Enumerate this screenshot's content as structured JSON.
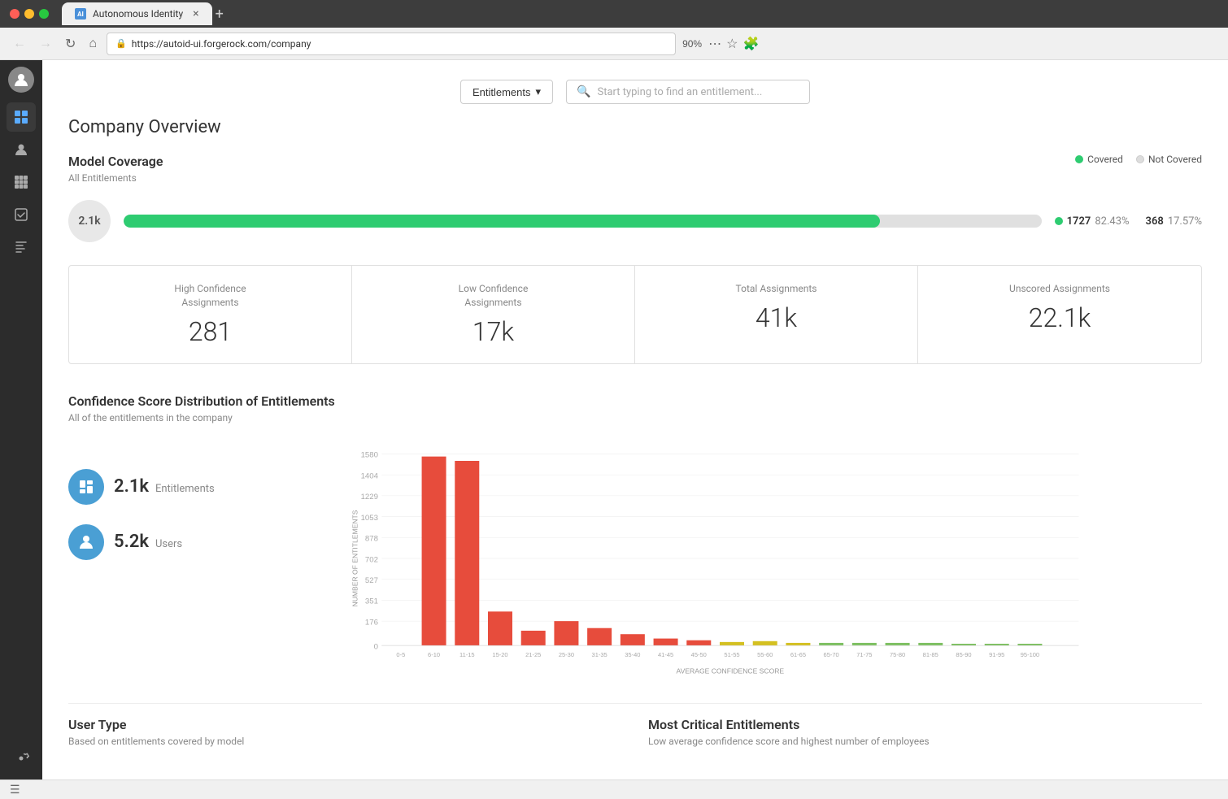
{
  "browser": {
    "traffic_lights": [
      "red",
      "yellow",
      "green"
    ],
    "tab_label": "Autonomous Identity",
    "tab_favicon_text": "AI",
    "address": "https://autoid-ui.forgerock.com/company",
    "zoom": "90%",
    "new_tab_label": "+"
  },
  "header": {
    "entitlements_btn": "Entitlements",
    "search_placeholder": "Start typing to find an entitlement..."
  },
  "page": {
    "title": "Company Overview"
  },
  "model_coverage": {
    "section_title": "Model Coverage",
    "section_subtitle": "All Entitlements",
    "legend": {
      "covered_label": "Covered",
      "not_covered_label": "Not Covered"
    },
    "total": "2.1k",
    "bar_fill_pct": 82.43,
    "covered_count": "1727",
    "covered_pct": "82.43%",
    "not_covered_count": "368",
    "not_covered_pct": "17.57%"
  },
  "stats": [
    {
      "label": "High Confidence\nAssignments",
      "value": "281"
    },
    {
      "label": "Low Confidence\nAssignments",
      "value": "17k"
    },
    {
      "label": "Total Assignments",
      "value": "41k"
    },
    {
      "label": "Unscored Assignments",
      "value": "22.1k"
    }
  ],
  "chart": {
    "title": "Confidence Score Distribution of Entitlements",
    "subtitle": "All of the entitlements in the company",
    "y_axis_label": "NUMBER OF ENTITLEMENTS",
    "x_axis_label": "AVERAGE CONFIDENCE SCORE",
    "y_ticks": [
      "0",
      "176",
      "351",
      "527",
      "702",
      "878",
      "1053",
      "1229",
      "1404",
      "1580"
    ],
    "x_labels": [
      "0-5",
      "6-10",
      "11-15",
      "15-20",
      "21-25",
      "25-30",
      "31-35",
      "35-40",
      "41-45",
      "45-50",
      "51-55",
      "55-60",
      "61-65",
      "65-70",
      "71-75",
      "75-80",
      "81-85",
      "85-90",
      "91-95",
      "95-100"
    ],
    "bars": [
      {
        "label": "0-5",
        "value": 0,
        "color": "#e74c3c"
      },
      {
        "label": "6-10",
        "value": 1560,
        "color": "#e74c3c"
      },
      {
        "label": "11-15",
        "value": 1520,
        "color": "#e74c3c"
      },
      {
        "label": "15-20",
        "value": 280,
        "color": "#e74c3c"
      },
      {
        "label": "21-25",
        "value": 120,
        "color": "#e74c3c"
      },
      {
        "label": "25-30",
        "value": 200,
        "color": "#e74c3c"
      },
      {
        "label": "31-35",
        "value": 140,
        "color": "#e74c3c"
      },
      {
        "label": "35-40",
        "value": 90,
        "color": "#e74c3c"
      },
      {
        "label": "41-45",
        "value": 60,
        "color": "#e74c3c"
      },
      {
        "label": "45-50",
        "value": 40,
        "color": "#e74c3c"
      },
      {
        "label": "51-55",
        "value": 30,
        "color": "#e0c020"
      },
      {
        "label": "55-60",
        "value": 35,
        "color": "#e0c020"
      },
      {
        "label": "61-65",
        "value": 25,
        "color": "#e0c020"
      },
      {
        "label": "65-70",
        "value": 20,
        "color": "#7dc060"
      },
      {
        "label": "71-75",
        "value": 20,
        "color": "#7dc060"
      },
      {
        "label": "75-80",
        "value": 25,
        "color": "#7dc060"
      },
      {
        "label": "81-85",
        "value": 18,
        "color": "#7dc060"
      },
      {
        "label": "85-90",
        "value": 15,
        "color": "#7dc060"
      },
      {
        "label": "91-95",
        "value": 12,
        "color": "#7dc060"
      },
      {
        "label": "95-100",
        "value": 10,
        "color": "#7dc060"
      }
    ],
    "entitlements_num": "2.1k",
    "entitlements_label": "Entitlements",
    "users_num": "5.2k",
    "users_label": "Users"
  },
  "bottom": {
    "user_type_title": "User Type",
    "user_type_subtitle": "Based on entitlements covered by model",
    "critical_title": "Most Critical Entitlements",
    "critical_subtitle": "Low average confidence score and highest number of employees"
  },
  "sidebar": {
    "items": [
      {
        "name": "grid-icon",
        "label": "Dashboard",
        "active": true
      },
      {
        "name": "user-icon",
        "label": "Users",
        "active": false
      },
      {
        "name": "apps-icon",
        "label": "Applications",
        "active": false
      },
      {
        "name": "check-icon",
        "label": "Reviews",
        "active": false
      },
      {
        "name": "rules-icon",
        "label": "Rules",
        "active": false
      },
      {
        "name": "settings-icon",
        "label": "Settings",
        "active": false
      }
    ]
  }
}
